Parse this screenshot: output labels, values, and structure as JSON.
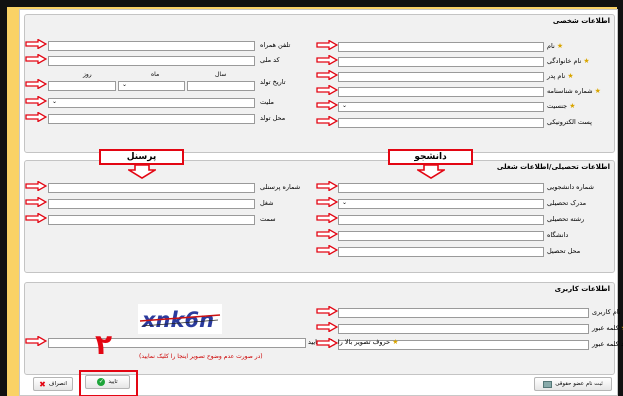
{
  "personal": {
    "title": "اطلاعات شخصی",
    "first_name_label": "نام",
    "last_name_label": "نام خانوادگی",
    "father_name_label": "نام پدر",
    "id_number_label": "شماره شناسنامه",
    "gender_label": "جنسیت",
    "email_label": "پست الکترونیکی",
    "mobile_label": "تلفن همراه",
    "national_code_label": "کد ملی",
    "birthdate_label": "تاریخ تولد",
    "year_label": "سال",
    "month_label": "ماه",
    "day_label": "روز",
    "nationality_label": "ملیت",
    "birthplace_label": "محل تولد"
  },
  "education": {
    "title": "اطلاعات تحصیلی/اطلاعات شغلی",
    "student_callout": "دانشجو",
    "personnel_callout": "پرسنل",
    "student_number_label": "شماره دانشجویی",
    "degree_label": "مدرک تحصیلی",
    "major_label": "رشته تحصیلی",
    "university_label": "دانشگاه",
    "study_place_label": "محل تحصیل",
    "personnel_number_label": "شماره پرسنلی",
    "job_label": "شغل",
    "position_label": "سمت"
  },
  "account": {
    "title": "اطلاعات کاربری",
    "username_label": "نام کاربری",
    "password_label": "کلمه عبور",
    "confirm_password_label": "تایید کلمه عبور",
    "captcha_label": "حروف تصویر بالا را وارد نمایید",
    "captcha_text": "xnk6n",
    "captcha_hint": "(در صورت عدم وضوح تصویر اینجا را کلیک نمایید)"
  },
  "footer": {
    "confirm_label": "تایید",
    "cancel_label": "انصراف",
    "register_label": "ثبت نام عضو حقوقی",
    "step_number": "۲"
  },
  "colors": {
    "accent_red": "#e30613",
    "background": "#fad265",
    "star": "#d9a500"
  }
}
